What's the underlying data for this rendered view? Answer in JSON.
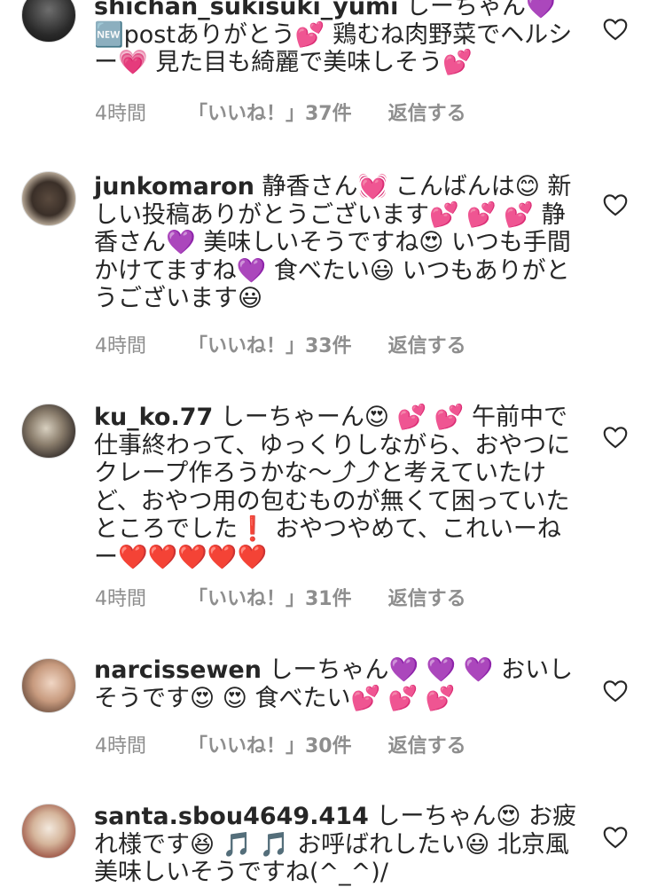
{
  "comments": [
    {
      "username": "shichan_sukisuki_yumi",
      "text": " しーちゃん💜🆕postありがとう💕 鶏むね肉野菜でヘルシー💗 見た目も綺麗で美味しそう💕",
      "time": "4時間",
      "likes": "「いいね！」37件",
      "reply": "返信する"
    },
    {
      "username": "junkomaron",
      "text": " 静香さん💓 こんばんは😊 新しい投稿ありがとうございます💕 💕 💕 静香さん💜 美味しいそうですね😍 いつも手間かけてますね💜 食べたい😃 いつもありがとうございます😃",
      "time": "4時間",
      "likes": "「いいね！」33件",
      "reply": "返信する"
    },
    {
      "username": "ku_ko.77",
      "text": " しーちゃーん😍 💕 💕 午前中で仕事終わって、ゆっくりしながら、おやつにクレープ作ろうかな〜⤴︎⤴︎と考えていたけど、おやつ用の包むものが無くて困っていたところでした❗️ おやつやめて、これいーねー❤️❤️❤️❤️❤️",
      "time": "4時間",
      "likes": "「いいね！」31件",
      "reply": "返信する"
    },
    {
      "username": "narcissewen",
      "text": " しーちゃん💜 💜 💜 おいしそうです😍 😍 食べたい💕 💕 💕",
      "time": "4時間",
      "likes": "「いいね！」30件",
      "reply": "返信する"
    },
    {
      "username": "santa.sbou4649.414",
      "text": " しーちゃん😍 お疲れ様です😆 🎵 🎵 お呼ばれしたい😃 北京風美味しいそうですね(^_^)/",
      "time": "",
      "likes": "",
      "reply": ""
    }
  ],
  "icons": {
    "like": "heart-outline-icon"
  },
  "colors": {
    "text": "#262626",
    "meta": "#8e8e8e",
    "divider": "#dbdbdb"
  }
}
